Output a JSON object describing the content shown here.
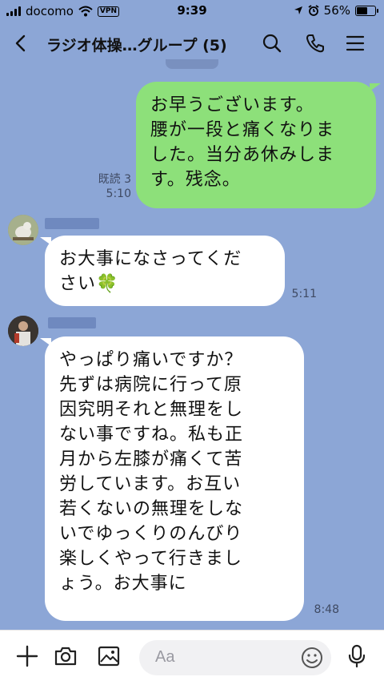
{
  "status_bar": {
    "carrier": "docomo",
    "vpn_label": "VPN",
    "time": "9:39",
    "battery_text": "56%",
    "battery_level": 0.56
  },
  "header": {
    "title": "ラジオ体操…グループ (5)",
    "icons": [
      "chevron-left-icon",
      "search-icon",
      "phone-icon",
      "menu-icon"
    ]
  },
  "messages": [
    {
      "side": "out",
      "text": "お早うございます。\n腰が一段と痛くなりま\nした。当分あ休みしま\nす。残念。",
      "read": "既読 3",
      "time": "5:10"
    },
    {
      "side": "in",
      "text": "お大事になさってくだ\nさい🍀",
      "time": "5:11"
    },
    {
      "side": "in",
      "text": "やっぱり痛いですか？\n先ずは病院に行って原\n因究明それと無理をし\nない事ですね。私も正\n月から左膝が痛くて苦\n労しています。お互い\n若くないの無理をしな\nいでゆっくりのんびり\n楽しくやって行きまし\nょう。お大事に",
      "time": "8:48"
    }
  ],
  "input_bar": {
    "placeholder": "Aa",
    "icons": [
      "plus-icon",
      "camera-icon",
      "image-icon",
      "emoji-icon",
      "microphone-icon"
    ]
  },
  "colors": {
    "background": "#8ca6d6",
    "outgoing_bubble": "#8de07a",
    "incoming_bubble": "#ffffff"
  }
}
